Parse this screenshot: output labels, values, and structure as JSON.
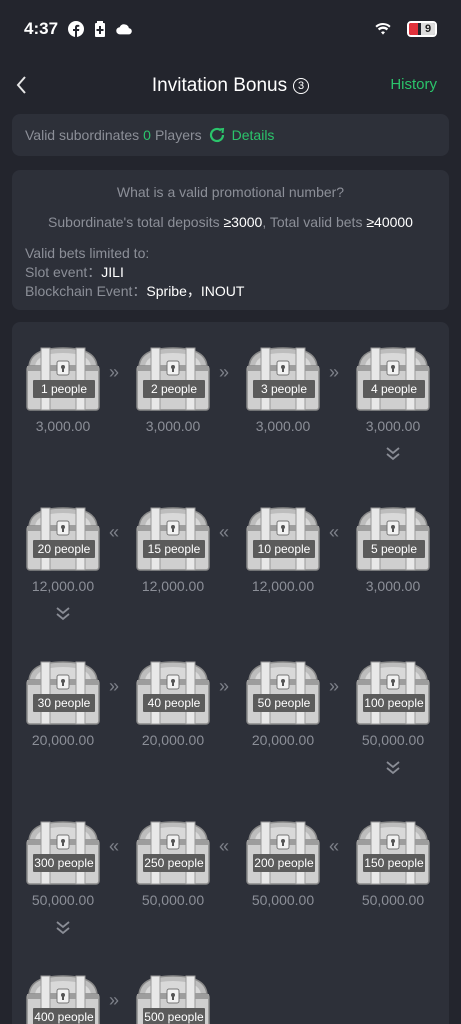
{
  "status": {
    "time": "4:37",
    "battery": "9"
  },
  "header": {
    "title": "Invitation Bonus",
    "badge": "3",
    "history_label": "History"
  },
  "subordinates": {
    "label": "Valid subordinates",
    "count": "0",
    "unit": "Players",
    "details_label": "Details"
  },
  "rules": {
    "question": "What is a valid promotional number?",
    "line_prefix": "Subordinate's total deposits ",
    "deposit": "≥3000",
    "line_mid": ", Total valid bets ",
    "bets": "≥40000",
    "limited_label": "Valid bets limited to:",
    "slot_label": "Slot event：",
    "slot_value": "JILI",
    "chain_label": "Blockchain Event：",
    "chain_value": "Spribe，INOUT"
  },
  "chests": [
    {
      "label": "1 people",
      "amount": "3,000.00"
    },
    {
      "label": "2 people",
      "amount": "3,000.00"
    },
    {
      "label": "3 people",
      "amount": "3,000.00"
    },
    {
      "label": "4 people",
      "amount": "3,000.00"
    },
    {
      "label": "5 people",
      "amount": "3,000.00"
    },
    {
      "label": "10 people",
      "amount": "12,000.00"
    },
    {
      "label": "15 people",
      "amount": "12,000.00"
    },
    {
      "label": "20 people",
      "amount": "12,000.00"
    },
    {
      "label": "30 people",
      "amount": "20,000.00"
    },
    {
      "label": "40 people",
      "amount": "20,000.00"
    },
    {
      "label": "50 people",
      "amount": "20,000.00"
    },
    {
      "label": "100 people",
      "amount": "50,000.00"
    },
    {
      "label": "150 people",
      "amount": "50,000.00"
    },
    {
      "label": "200 people",
      "amount": "50,000.00"
    },
    {
      "label": "250 people",
      "amount": "50,000.00"
    },
    {
      "label": "300 people",
      "amount": "50,000.00"
    },
    {
      "label": "400 people",
      "amount": ""
    },
    {
      "label": "500 people",
      "amount": ""
    }
  ],
  "colors": {
    "background": "#23252d",
    "card": "#2d3039",
    "accent": "#2bc46b"
  }
}
